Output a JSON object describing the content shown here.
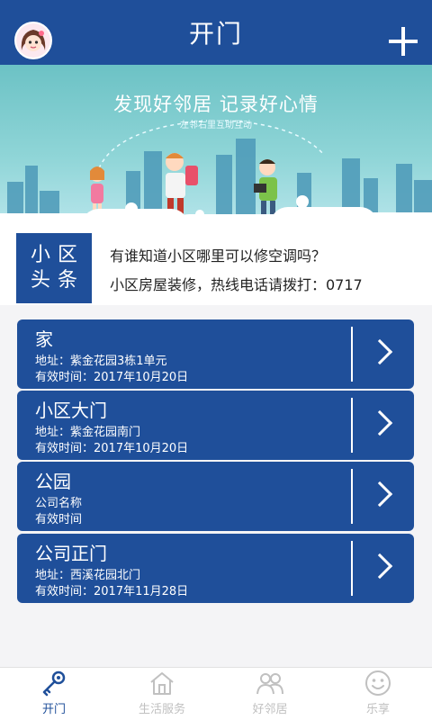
{
  "header": {
    "title": "开门",
    "accent_color": "#1f4f9a"
  },
  "banner": {
    "title": "发现好邻居 记录好心情",
    "subtitle": "左邻右里互助互动"
  },
  "news": {
    "badge_line1": "小区",
    "badge_line2": "头条",
    "line1": "有谁知道小区哪里可以修空调吗？",
    "line2": "小区房屋装修，热线电话请拨打：0717"
  },
  "cards": [
    {
      "name": "家",
      "address": "地址：紫金花园3栋1单元",
      "valid": "有效时间：2017年10月20日"
    },
    {
      "name": "小区大门",
      "address": "地址：紫金花园南门",
      "valid": "有效时间：2017年10月20日"
    },
    {
      "name": "公园",
      "address": "公司名称",
      "valid": "有效时间"
    },
    {
      "name": "公司正门",
      "address": "地址：西溪花园北门",
      "valid": "有效时间：2017年11月28日"
    }
  ],
  "nav": [
    {
      "label": "开门",
      "icon": "key-icon",
      "active": true
    },
    {
      "label": "生活服务",
      "icon": "home-icon",
      "active": false
    },
    {
      "label": "好邻居",
      "icon": "people-icon",
      "active": false
    },
    {
      "label": "乐享",
      "icon": "smile-icon",
      "active": false
    }
  ]
}
